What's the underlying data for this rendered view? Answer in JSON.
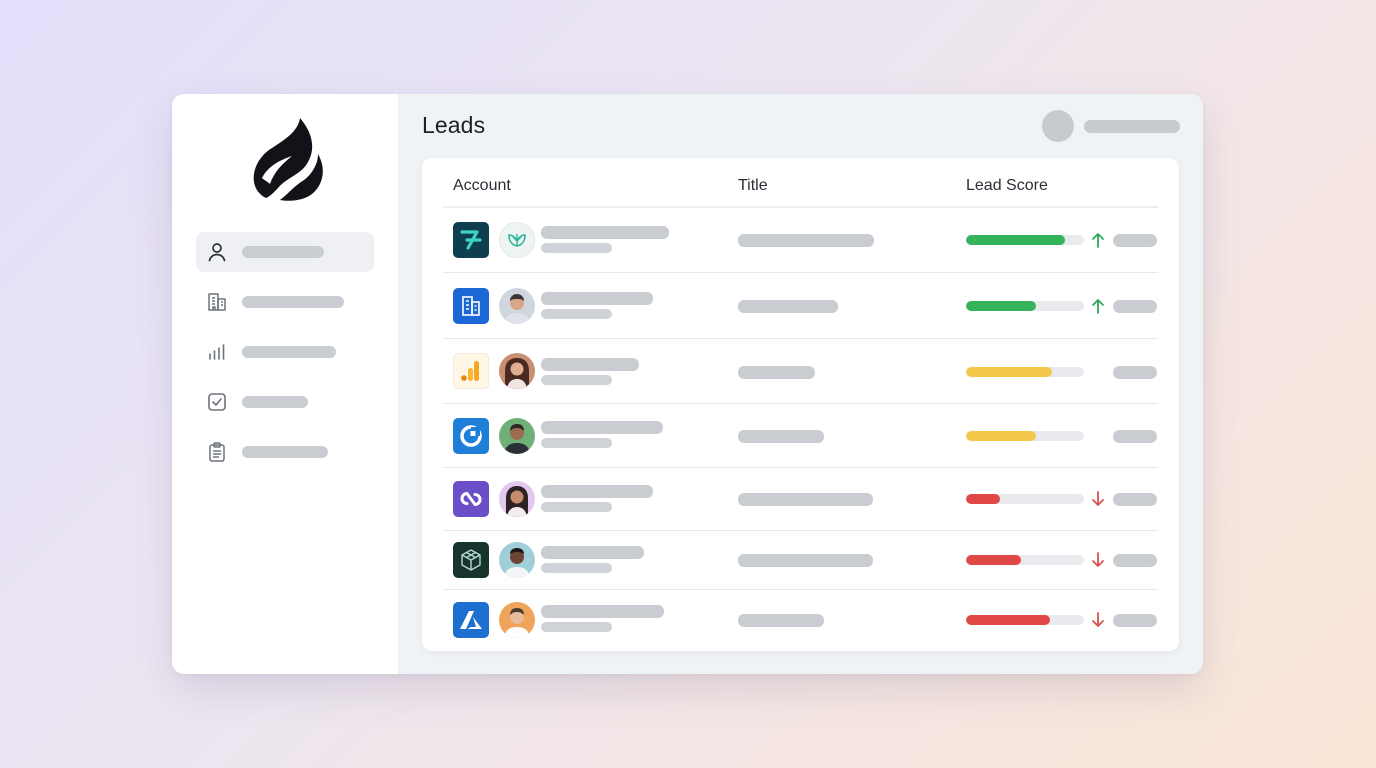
{
  "page": {
    "title": "Leads"
  },
  "sidebar": {
    "items": [
      {
        "icon": "user-icon",
        "active": true
      },
      {
        "icon": "building-icon",
        "active": false
      },
      {
        "icon": "bar-chart-icon",
        "active": false
      },
      {
        "icon": "checkbox-icon",
        "active": false
      },
      {
        "icon": "clipboard-icon",
        "active": false
      }
    ]
  },
  "table": {
    "columns": [
      "Account",
      "Title",
      "Lead Score"
    ],
    "rows": [
      {
        "logo": "teal-arrow-logo",
        "avatar": "leaf-logo-avatar",
        "score_pct": 84,
        "score_color": "#34b35a",
        "trend": "up"
      },
      {
        "logo": "blue-building-logo",
        "avatar": "person-avatar",
        "score_pct": 59,
        "score_color": "#34b35a",
        "trend": "up"
      },
      {
        "logo": "analytics-bars-logo",
        "avatar": "person-avatar",
        "score_pct": 73,
        "score_color": "#f2c94c",
        "trend": "none"
      },
      {
        "logo": "blue-circle-logo",
        "avatar": "person-avatar",
        "score_pct": 59,
        "score_color": "#f2c94c",
        "trend": "none"
      },
      {
        "logo": "purple-infinity-logo",
        "avatar": "person-avatar",
        "score_pct": 29,
        "score_color": "#e04848",
        "trend": "down"
      },
      {
        "logo": "dark-cube-logo",
        "avatar": "person-avatar",
        "score_pct": 47,
        "score_color": "#e04848",
        "trend": "down"
      },
      {
        "logo": "azure-logo",
        "avatar": "person-avatar",
        "score_pct": 71,
        "score_color": "#e04848",
        "trend": "down"
      }
    ]
  },
  "colors": {
    "trend_up": "#2fa55a",
    "trend_down": "#d9534f",
    "placeholder": "#c9ccd1"
  }
}
